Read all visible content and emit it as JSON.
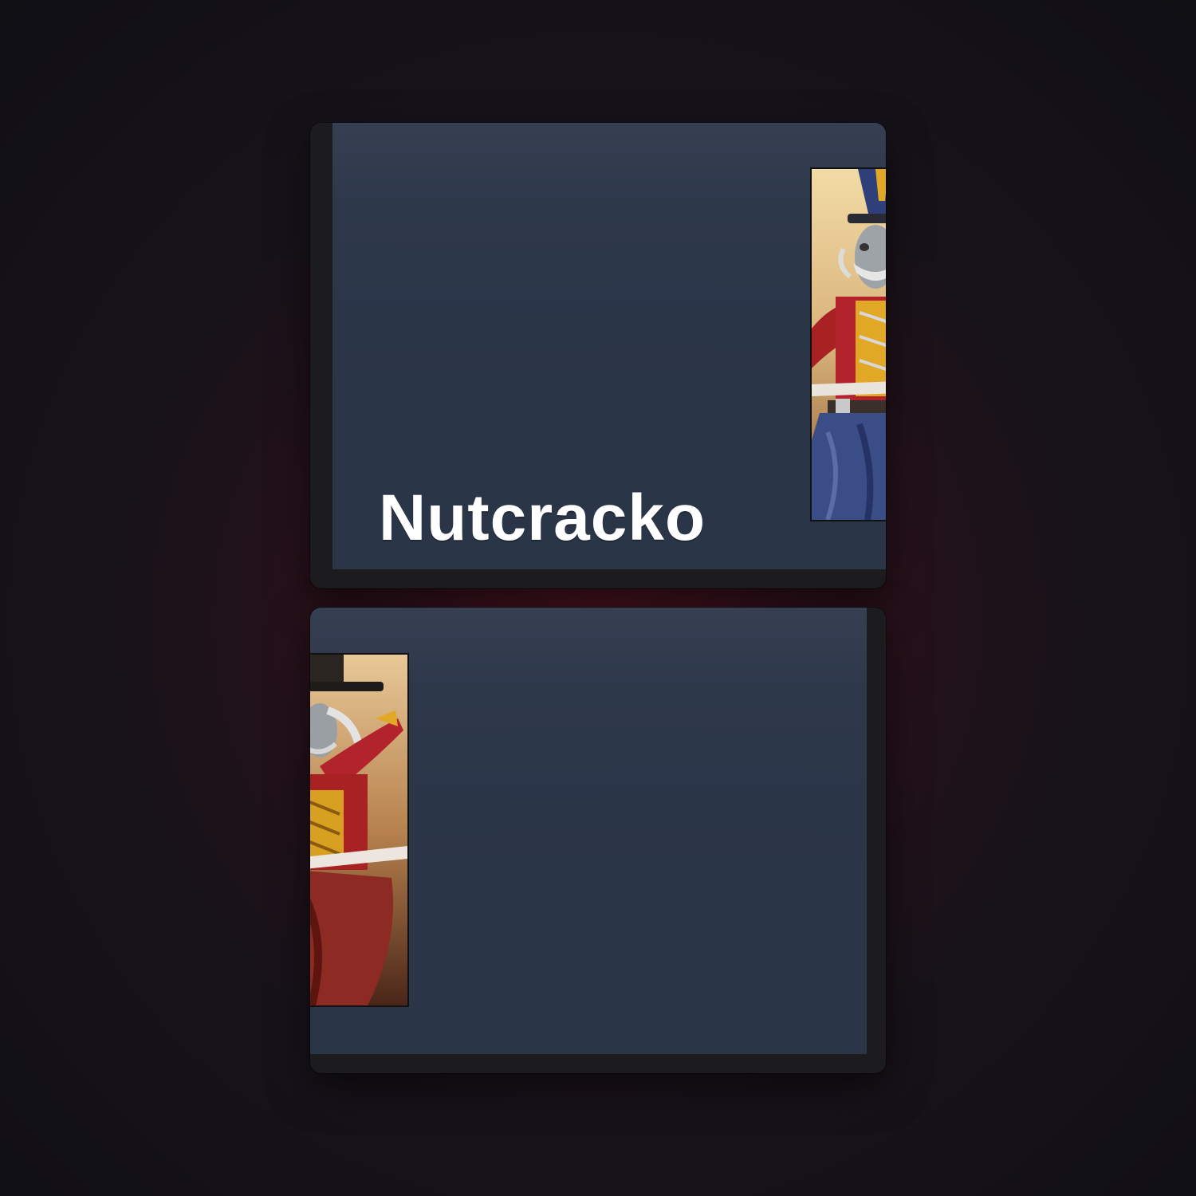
{
  "card": {
    "name": "Nutcracko"
  },
  "colors": {
    "panel": "#2b3548",
    "frame": "#1c1c1f",
    "text": "#ffffff",
    "accent_red": "#b3232b",
    "accent_gold": "#e0a825",
    "accent_blue": "#2f3f7a"
  },
  "icons": {
    "hero_art": "nutcracker-soldier-portrait"
  }
}
